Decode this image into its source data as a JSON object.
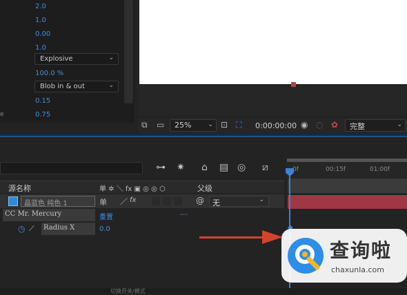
{
  "effect_controls": {
    "properties": [
      {
        "label": "",
        "value": "2.0"
      },
      {
        "label": "",
        "value": "1.0"
      },
      {
        "label": "",
        "value": "0.00"
      },
      {
        "label": "",
        "value": "1.0"
      },
      {
        "label": "",
        "dropdown": "Explosive"
      },
      {
        "label": "",
        "value": "100.0 %"
      },
      {
        "label": "",
        "dropdown": "Blob in & out"
      },
      {
        "label": "",
        "value": "0.15"
      },
      {
        "label": "e",
        "value": "0.75"
      }
    ]
  },
  "viewer_toolbar": {
    "zoom": "25%",
    "timecode": "0:00:00:00",
    "resolution": "完整"
  },
  "timeline": {
    "columns": {
      "source_name": "源名称",
      "switches": "单 ✲ ＼ fx ▣ ◎ ◎ ⬡",
      "parent": "父级"
    },
    "layer": {
      "name": "晶蓝色 纯色 1",
      "parent_value": "无",
      "color": "#2f8ad8"
    },
    "effect": {
      "name": "CC Mr. Mercury",
      "reset_label": "重置",
      "dash": "---"
    },
    "property": {
      "name": "Radius X",
      "value": "0.0"
    },
    "ruler_labels": [
      "0f",
      "00:15f",
      "01:00f"
    ]
  },
  "watermark": {
    "title": "查询啦",
    "subtitle": "chaxunla.com"
  },
  "footer": {
    "text": "切换开关/模式"
  },
  "colors": {
    "accent": "#3a82d8",
    "layer_bar": "#a03843",
    "arrow": "#d4432e"
  }
}
